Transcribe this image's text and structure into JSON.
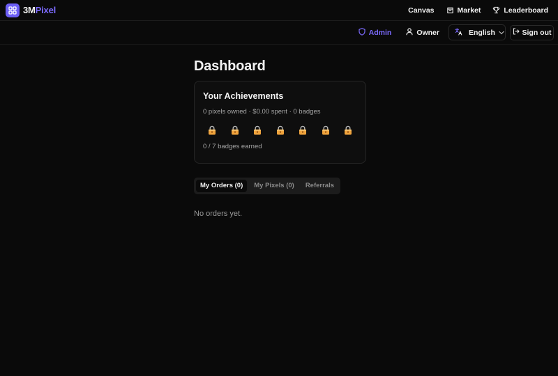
{
  "app": {
    "name_main": "3M",
    "name_accent": "Pixel",
    "brand_color": "#6d5ff5",
    "accent_text_color": "#7c6bff"
  },
  "topnav": {
    "items": [
      {
        "label": "Canvas",
        "icon": ""
      },
      {
        "label": "Market",
        "icon": "bag-icon"
      },
      {
        "label": "Leaderboard",
        "icon": "trophy-icon"
      }
    ]
  },
  "subbar": {
    "admin_label": "Admin",
    "owner_label": "Owner",
    "language_value": "English",
    "signout_label": "Sign out"
  },
  "page": {
    "title": "Dashboard"
  },
  "achievements": {
    "title": "Your Achievements",
    "stats": "0 pixels owned · $0.00 spent · 0 badges",
    "badge_count": 7,
    "badge_icon": "lock-icon",
    "progress": "0 / 7 badges earned"
  },
  "tabs": {
    "items": [
      {
        "label": "My Orders (0)",
        "active": true
      },
      {
        "label": "My Pixels (0)",
        "active": false
      },
      {
        "label": "Referrals",
        "active": false
      }
    ]
  },
  "orders": {
    "empty_message": "No orders yet."
  }
}
